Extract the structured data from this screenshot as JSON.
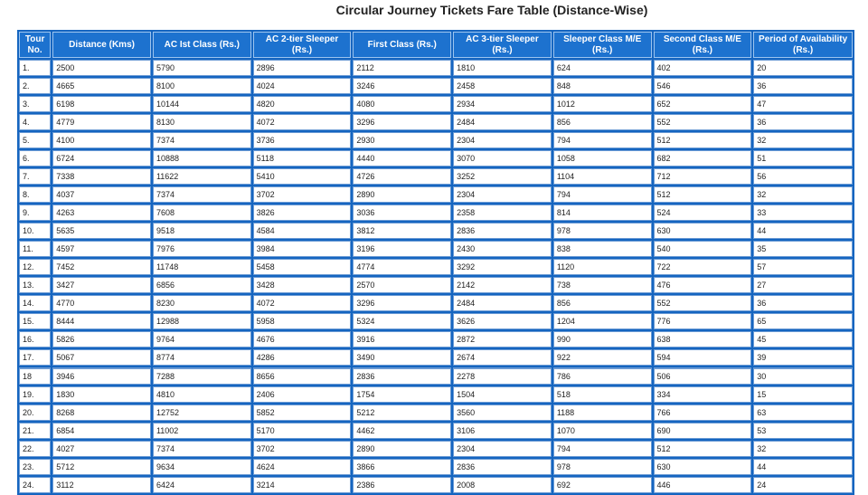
{
  "page": {
    "title": "Circular Journey Tickets Fare Table (Distance-Wise)"
  },
  "table": {
    "headers": [
      "Tour No.",
      "Distance (Kms)",
      "AC Ist Class (Rs.)",
      "AC 2-tier Sleeper (Rs.)",
      "First Class (Rs.)",
      "AC 3-tier Sleeper (Rs.)",
      "Sleeper Class M/E (Rs.)",
      "Second Class M/E (Rs.)",
      "Period of Availability (Rs.)"
    ],
    "rows": [
      [
        "1.",
        "2500",
        "5790",
        "2896",
        "2112",
        "1810",
        "624",
        "402",
        "20"
      ],
      [
        "2.",
        "4665",
        "8100",
        "4024",
        "3246",
        "2458",
        "848",
        "546",
        "36"
      ],
      [
        "3.",
        "6198",
        "10144",
        "4820",
        "4080",
        "2934",
        "1012",
        "652",
        "47"
      ],
      [
        "4.",
        "4779",
        "8130",
        "4072",
        "3296",
        "2484",
        "856",
        "552",
        "36"
      ],
      [
        "5.",
        "4100",
        "7374",
        "3736",
        "2930",
        "2304",
        "794",
        "512",
        "32"
      ],
      [
        "6.",
        "6724",
        "10888",
        "5118",
        "4440",
        "3070",
        "1058",
        "682",
        "51"
      ],
      [
        "7.",
        "7338",
        "11622",
        "5410",
        "4726",
        "3252",
        "1104",
        "712",
        "56"
      ],
      [
        "8.",
        "4037",
        "7374",
        "3702",
        "2890",
        "2304",
        "794",
        "512",
        "32"
      ],
      [
        "9.",
        "4263",
        "7608",
        "3826",
        "3036",
        "2358",
        "814",
        "524",
        "33"
      ],
      [
        "10.",
        "5635",
        "9518",
        "4584",
        "3812",
        "2836",
        "978",
        "630",
        "44"
      ],
      [
        "11.",
        "4597",
        "7976",
        "3984",
        "3196",
        "2430",
        "838",
        "540",
        "35"
      ],
      [
        "12.",
        "7452",
        "11748",
        "5458",
        "4774",
        "3292",
        "1120",
        "722",
        "57"
      ],
      [
        "13.",
        "3427",
        "6856",
        "3428",
        "2570",
        "2142",
        "738",
        "476",
        "27"
      ],
      [
        "14.",
        "4770",
        "8230",
        "4072",
        "3296",
        "2484",
        "856",
        "552",
        "36"
      ],
      [
        "15.",
        "8444",
        "12988",
        "5958",
        "5324",
        "3626",
        "1204",
        "776",
        "65"
      ],
      [
        "16.",
        "5826",
        "9764",
        "4676",
        "3916",
        "2872",
        "990",
        "638",
        "45"
      ],
      [
        "17.",
        "5067",
        "8774",
        "4286",
        "3490",
        "2674",
        "922",
        "594",
        "39"
      ],
      [
        "18",
        "3946",
        "7288",
        "8656",
        "2836",
        "2278",
        "786",
        "506",
        "30"
      ],
      [
        "19.",
        "1830",
        "4810",
        "2406",
        "1754",
        "1504",
        "518",
        "334",
        "15"
      ],
      [
        "20.",
        "8268",
        "12752",
        "5852",
        "5212",
        "3560",
        "1188",
        "766",
        "63"
      ],
      [
        "21.",
        "6854",
        "11002",
        "5170",
        "4462",
        "3106",
        "1070",
        "690",
        "53"
      ],
      [
        "22.",
        "4027",
        "7374",
        "3702",
        "2890",
        "2304",
        "794",
        "512",
        "32"
      ],
      [
        "23.",
        "5712",
        "9634",
        "4624",
        "3866",
        "2836",
        "978",
        "630",
        "44"
      ],
      [
        "24.",
        "3112",
        "6424",
        "3214",
        "2386",
        "2008",
        "692",
        "446",
        "24"
      ]
    ]
  }
}
